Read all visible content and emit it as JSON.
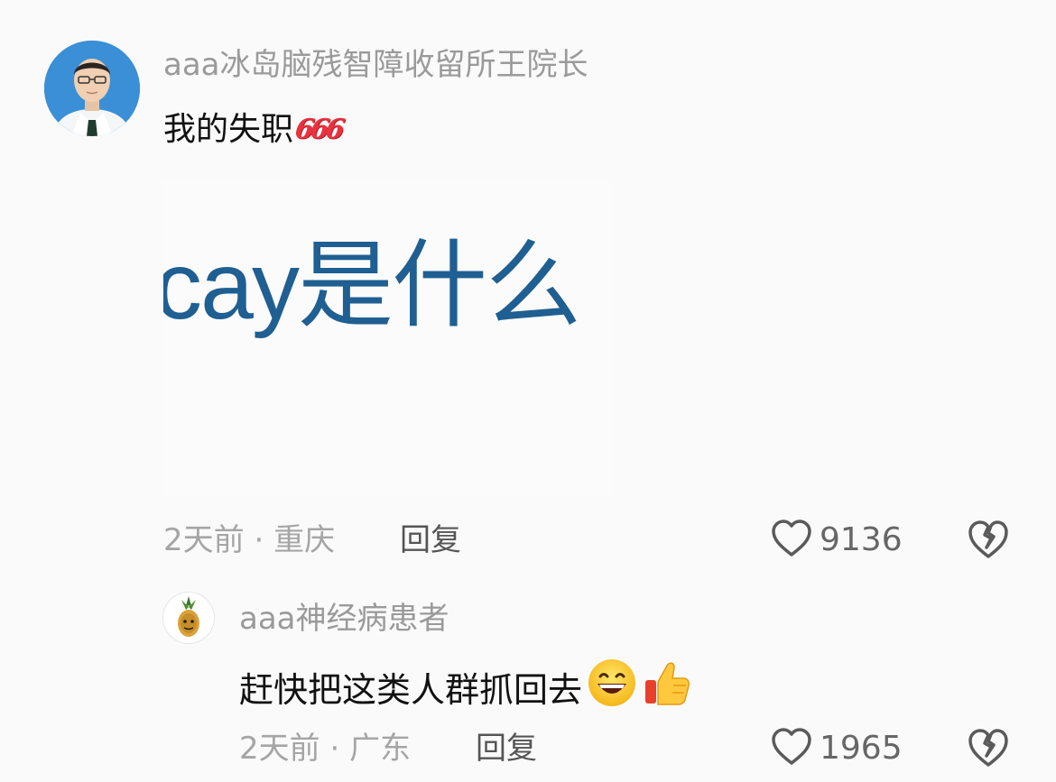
{
  "main_comment": {
    "username": "aaa冰岛脑残智障收留所王院长",
    "text": "我的失职",
    "emoji_666": "666",
    "image_text": "cay是什么",
    "time": "2天前",
    "separator": "·",
    "location": "重庆",
    "reply_label": "回复",
    "likes": "9136"
  },
  "sub_comment": {
    "username": "aaa神经病患者",
    "text": "赶快把这类人群抓回去",
    "time": "2天前",
    "separator": "·",
    "location": "广东",
    "reply_label": "回复",
    "likes": "1965"
  },
  "colors": {
    "background": "#fafafa",
    "username": "#9a9a9a",
    "meta": "#a5a5a5",
    "image_text": "#1f5f92",
    "emoji_666": "#e8323f"
  },
  "icons": [
    "heart-outline-icon",
    "broken-heart-icon",
    "grinning-face-icon",
    "thumbs-up-icon"
  ]
}
